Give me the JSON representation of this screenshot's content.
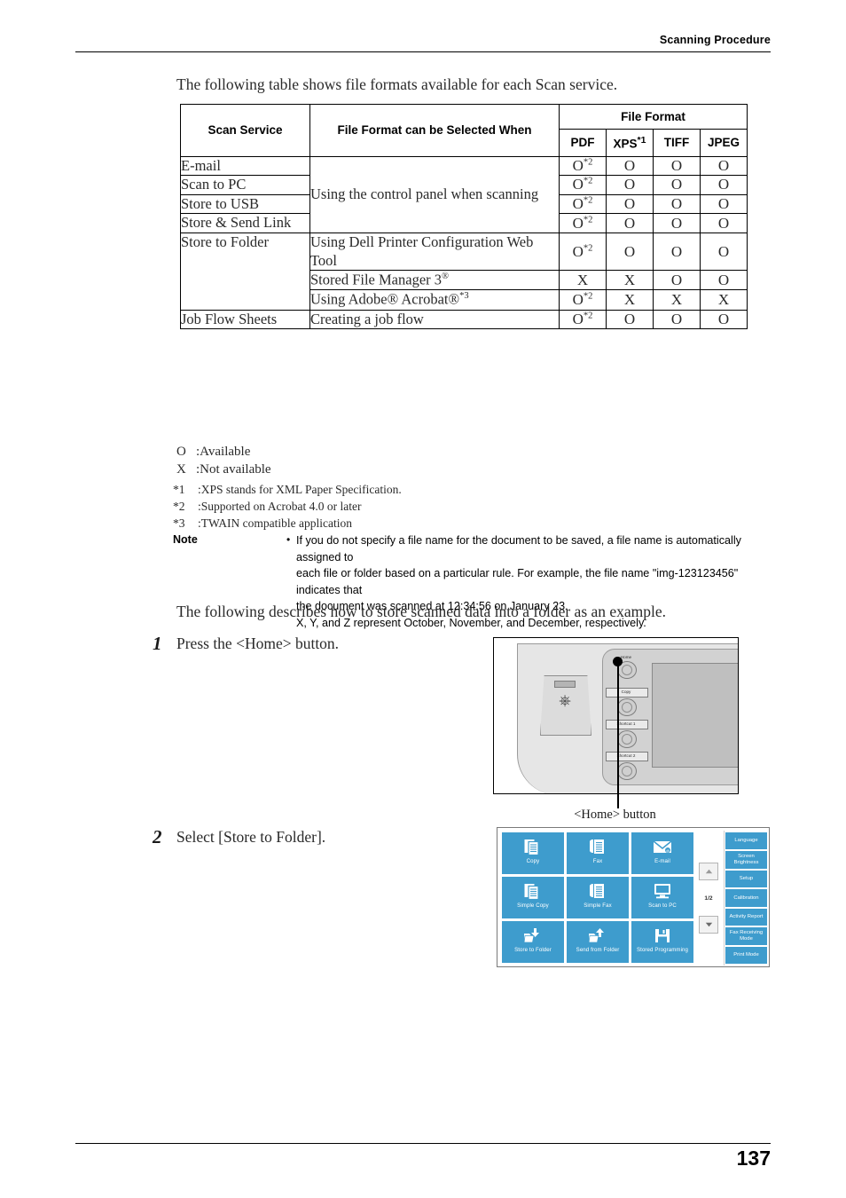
{
  "header": {
    "title": "Scanning Procedure"
  },
  "footer": {
    "page_number": "137"
  },
  "intro": {
    "line1": "The following table shows file formats available for each Scan service.",
    "line2": "The following describes how to store scanned data into a folder as an example."
  },
  "table": {
    "headers": {
      "scan_service": "Scan Service",
      "when": "File Format can be Selected When",
      "file_format": "File Format",
      "pdf": "PDF",
      "xps": "XPS",
      "xps_note": "*1",
      "tiff": "TIFF",
      "jpeg": "JPEG"
    },
    "rows": [
      {
        "service": "E-mail",
        "when": "Using the control panel when scanning",
        "pdf": "O",
        "pdf_note": "*2",
        "xps": "O",
        "tiff": "O",
        "jpeg": "O"
      },
      {
        "service": "Scan to PC",
        "when": "",
        "pdf": "O",
        "pdf_note": "*2",
        "xps": "O",
        "tiff": "O",
        "jpeg": "O"
      },
      {
        "service": "Store to USB",
        "when": "",
        "pdf": "O",
        "pdf_note": "*2",
        "xps": "O",
        "tiff": "O",
        "jpeg": "O"
      },
      {
        "service": "Store & Send Link",
        "when": "",
        "pdf": "O",
        "pdf_note": "*2",
        "xps": "O",
        "tiff": "O",
        "jpeg": "O"
      },
      {
        "service": "Store to Folder",
        "when": "Using Dell Printer Configuration Web Tool",
        "pdf": "O",
        "pdf_note": "*2",
        "xps": "O",
        "tiff": "O",
        "jpeg": "O"
      },
      {
        "service": "",
        "when": "Stored File Manager 3",
        "when_sup": "®",
        "pdf": "X",
        "pdf_note": "",
        "xps": "X",
        "tiff": "O",
        "jpeg": "O"
      },
      {
        "service": "",
        "when": "Using Adobe® Acrobat®",
        "when_note": "*3",
        "pdf": "O",
        "pdf_note": "*2",
        "xps": "X",
        "tiff": "X",
        "jpeg": "X"
      },
      {
        "service": "Job Flow Sheets",
        "when": "Creating a job flow",
        "pdf": "O",
        "pdf_note": "*2",
        "xps": "O",
        "tiff": "O",
        "jpeg": "O"
      }
    ]
  },
  "legend": [
    {
      "key": "O",
      "text": ":Available"
    },
    {
      "key": "X",
      "text": ":Not available"
    }
  ],
  "footnotes": [
    {
      "key": "*1",
      "text": ":XPS stands for XML Paper Specification."
    },
    {
      "key": "*2",
      "text": ":Supported on Acrobat 4.0 or later"
    },
    {
      "key": "*3",
      "text": ":TWAIN compatible application"
    }
  ],
  "note": {
    "label": "Note",
    "lines": [
      "If you do not specify a file name for the document to be saved, a file name is automatically assigned to",
      "each file or folder based on a particular rule. For example, the file name \"img-123123456\" indicates that",
      "the document was scanned at 12:34:56 on January 23.",
      "X, Y, and Z represent October, November, and December, respectively."
    ]
  },
  "steps": [
    {
      "number": "1",
      "text": "Press the <Home> button."
    },
    {
      "number": "2",
      "text": "Select [Store to Folder]."
    }
  ],
  "figure_control_panel": {
    "caption": "<Home> button",
    "buttons": [
      {
        "label": "Home"
      },
      {
        "label": "Copy"
      },
      {
        "label": "Shortcut 1"
      },
      {
        "label": "Shortcut 2"
      }
    ]
  },
  "figure_touchscreen": {
    "accent_color": "#3e9ccd",
    "page_indicator": "1/2",
    "tiles": [
      {
        "label": "Copy",
        "icon": "copy-icon"
      },
      {
        "label": "Fax",
        "icon": "fax-icon"
      },
      {
        "label": "E-mail",
        "icon": "envelope-icon"
      },
      {
        "label": "Simple Copy",
        "icon": "copy-icon"
      },
      {
        "label": "Simple Fax",
        "icon": "fax-icon"
      },
      {
        "label": "Scan to PC",
        "icon": "monitor-icon"
      },
      {
        "label": "Store to Folder",
        "icon": "folder-down-icon"
      },
      {
        "label": "Send from Folder",
        "icon": "folder-up-icon"
      },
      {
        "label": "Stored Programming",
        "icon": "floppy-icon"
      }
    ],
    "side_buttons": [
      {
        "label": "Language"
      },
      {
        "label": "Screen Brightness"
      },
      {
        "label": "Setup"
      },
      {
        "label": "Calibration"
      },
      {
        "label": "Activity Report"
      },
      {
        "label": "Fax Receiving Mode"
      },
      {
        "label": "Print Mode"
      }
    ]
  }
}
